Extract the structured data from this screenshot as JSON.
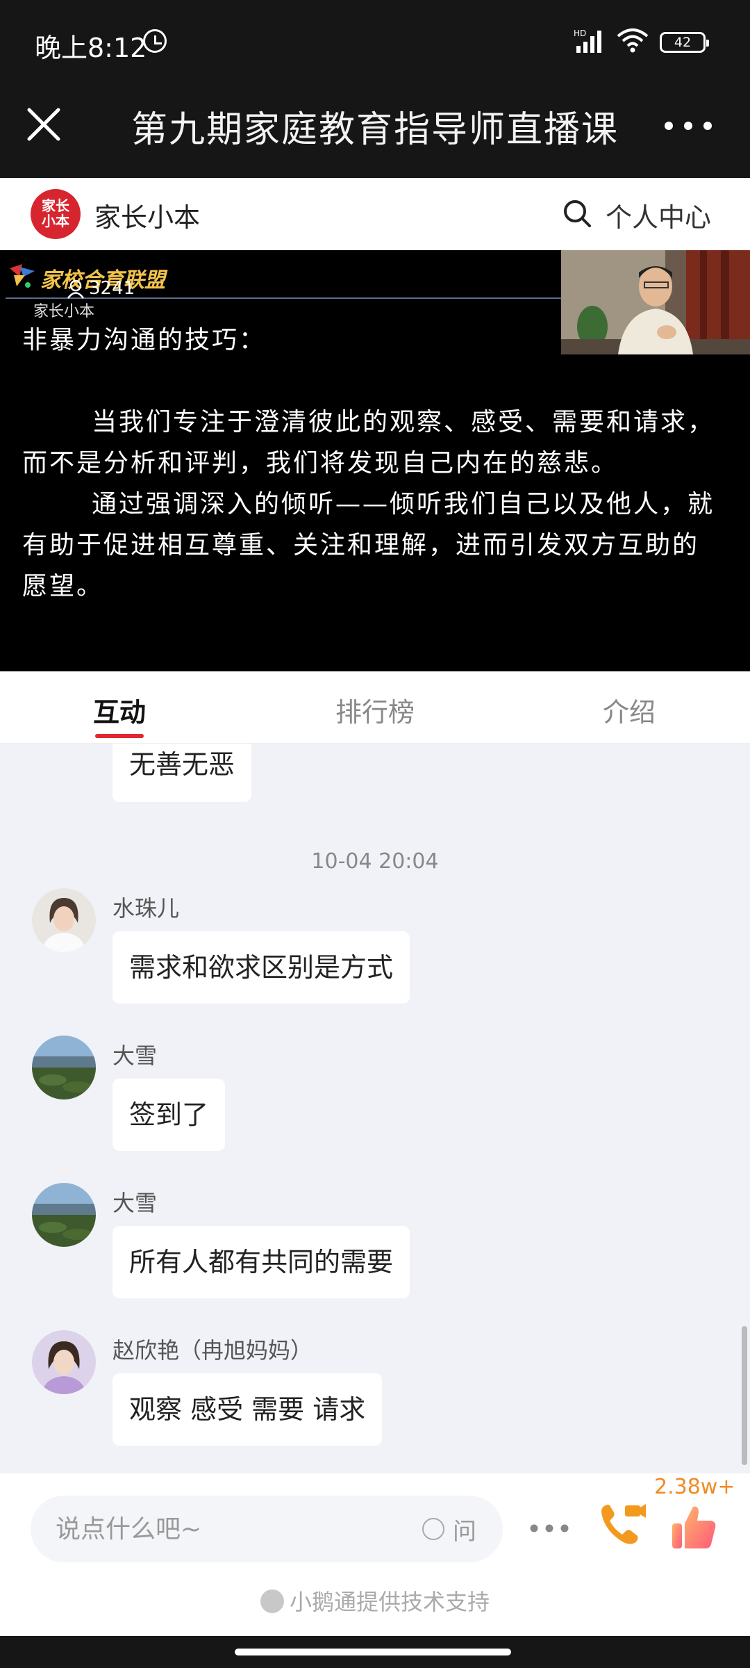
{
  "status_bar": {
    "time": "晚上8:12",
    "network": "HD",
    "battery": "42"
  },
  "nav": {
    "title": "第九期家庭教育指导师直播课"
  },
  "brand": {
    "logo_text": "家长小本",
    "name": "家长小本",
    "user_center": "个人中心"
  },
  "video": {
    "channel": "家校合育联盟",
    "subchannel": "家长小本",
    "viewer_count": "3241",
    "slide": {
      "heading": "非暴力沟通的技巧：",
      "paragraphs": [
        "当我们专注于澄清彼此的观察、感受、需要和请求，而不是分析和评判，我们将发现自己内在的慈悲。",
        "通过强调深入的倾听——倾听我们自己以及他人，就有助于促进相互尊重、关注和理解，进而引发双方互助的愿望。"
      ]
    }
  },
  "tabs": [
    {
      "label": "互动",
      "active": true
    },
    {
      "label": "排行榜",
      "active": false
    },
    {
      "label": "介绍",
      "active": false
    }
  ],
  "chat": {
    "partial_message": "无善无恶",
    "timestamp": "10-04 20:04",
    "messages": [
      {
        "sender": "水珠儿",
        "text": "需求和欲求区别是方式",
        "avatar": "woman-portrait"
      },
      {
        "sender": "大雪",
        "text": "签到了",
        "avatar": "landscape"
      },
      {
        "sender": "大雪",
        "text": "所有人都有共同的需要",
        "avatar": "landscape"
      },
      {
        "sender": "赵欣艳（冉旭妈妈）",
        "text": "观察 感受 需要 请求",
        "avatar": "woman-portrait-pink"
      }
    ]
  },
  "bottom": {
    "input_placeholder": "说点什么吧~",
    "ask_label": "问",
    "like_count": "2.38w+",
    "powered_by": "小鹅通提供技术支持"
  },
  "colors": {
    "accent": "#e0292e",
    "brand": "#d7252f",
    "like": "#f08a24"
  }
}
